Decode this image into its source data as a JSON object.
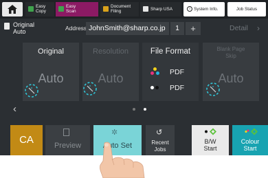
{
  "topbar": {
    "home_icon": "home-icon",
    "tabs": [
      {
        "label_1": "Easy",
        "label_2": "Copy",
        "icon": "copy-icon",
        "icon_color": "#3fa34d"
      },
      {
        "label_1": "Easy",
        "label_2": "Scan",
        "icon": "scan-icon",
        "icon_color": "#3fa34d",
        "active": true,
        "active_color": "#8c1a64"
      },
      {
        "label_1": "Document",
        "label_2": "Filing",
        "icon": "filing-icon",
        "icon_color": "#d9a21b"
      },
      {
        "label_1": "Sharp USA",
        "icon": "web-icon",
        "icon_color": "#e6e6e6"
      },
      {
        "label_1": "System Info.",
        "icon": "info-icon"
      },
      {
        "label_1": "Job Status"
      }
    ]
  },
  "address_row": {
    "original_mode_1": "Original",
    "original_mode_2": "Auto",
    "address_label": "Address",
    "address_value": "JohnSmith@sharp.co.jp",
    "address_count": "1",
    "add_symbol": "+",
    "detail_label": "Detail",
    "detail_chevron": "›"
  },
  "cards": {
    "original": {
      "title": "Original",
      "value": "Auto"
    },
    "resolution": {
      "title": "Resolution",
      "value": "Auto"
    },
    "file_format": {
      "title": "File Format",
      "rows": [
        {
          "label": "PDF",
          "mode": "colour"
        },
        {
          "label": "PDF",
          "mode": "bw"
        }
      ]
    },
    "blank_skip": {
      "title_1": "Blank Page",
      "title_2": "Skip",
      "value": "Auto"
    }
  },
  "pager": {
    "prev": "‹",
    "pages": 2,
    "current": 2
  },
  "bottom": {
    "ca_label": "CA",
    "preview_label": "Preview",
    "autoset_label": "Auto Set",
    "recent_1": "Recent",
    "recent_2": "Jobs",
    "bw_1": "B/W",
    "bw_2": "Start",
    "colour_1": "Colour",
    "colour_2": "Start"
  },
  "colors": {
    "ca": "#c28a15",
    "autoset": "#7ad4d7",
    "colour_start": "#18a3b1",
    "tap_indicator": "#2fc6d8"
  }
}
